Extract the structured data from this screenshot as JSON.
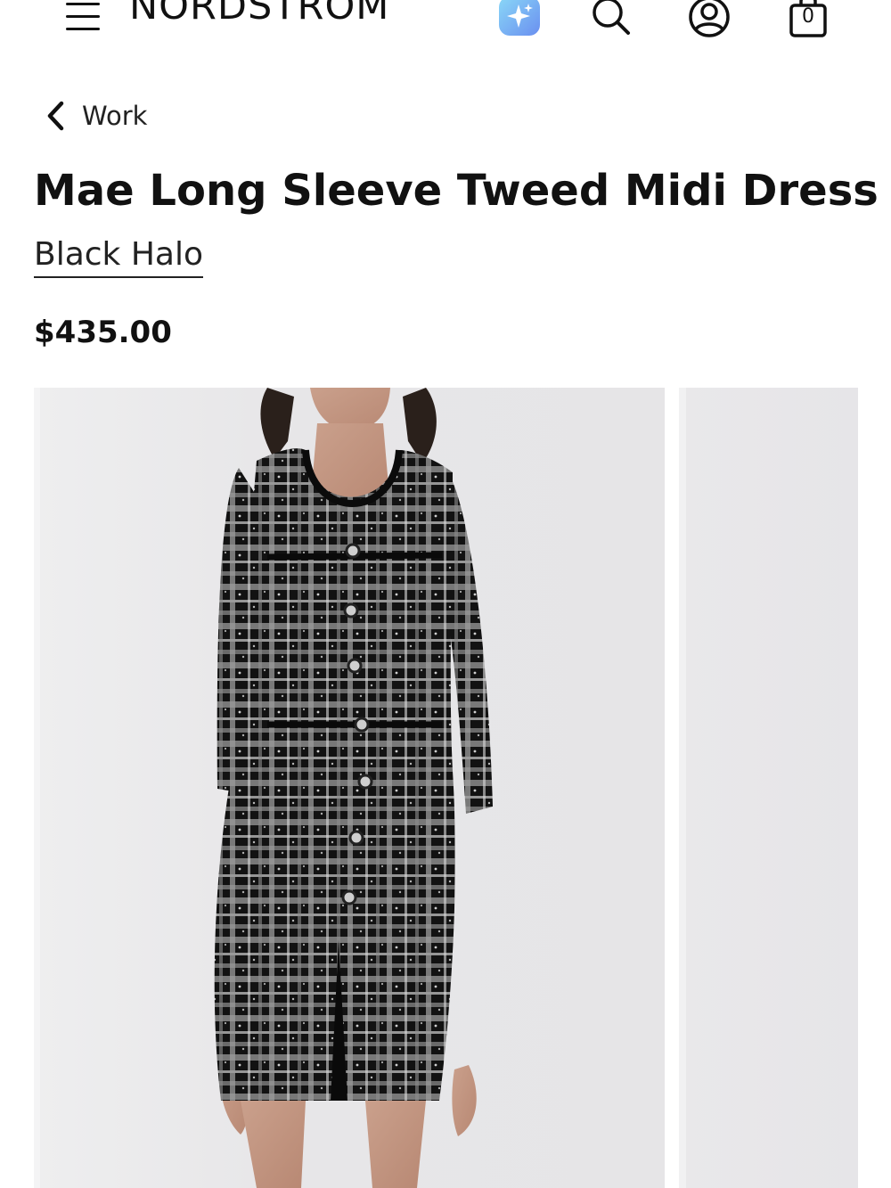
{
  "header": {
    "logo": "NORDSTROM",
    "menu_icon": "hamburger-menu-icon",
    "ai_icon": "sparkle-assistant-icon",
    "search_icon": "search-icon",
    "account_icon": "account-icon",
    "bag_icon": "shopping-bag-icon",
    "bag_count": "0"
  },
  "breadcrumb": {
    "back_icon": "chevron-left-icon",
    "label": "Work"
  },
  "product": {
    "title": "Mae Long Sleeve Tweed Midi Dress",
    "brand": "Black Halo",
    "price": "$435.00"
  },
  "gallery": {
    "images": [
      "product-photo-front",
      "product-photo-next"
    ]
  },
  "colors": {
    "text": "#111111",
    "background": "#ffffff",
    "photo_bg": "#e7e6e8",
    "ai_gradient_start": "#7fd3f5",
    "ai_gradient_end": "#5a8cf0"
  }
}
